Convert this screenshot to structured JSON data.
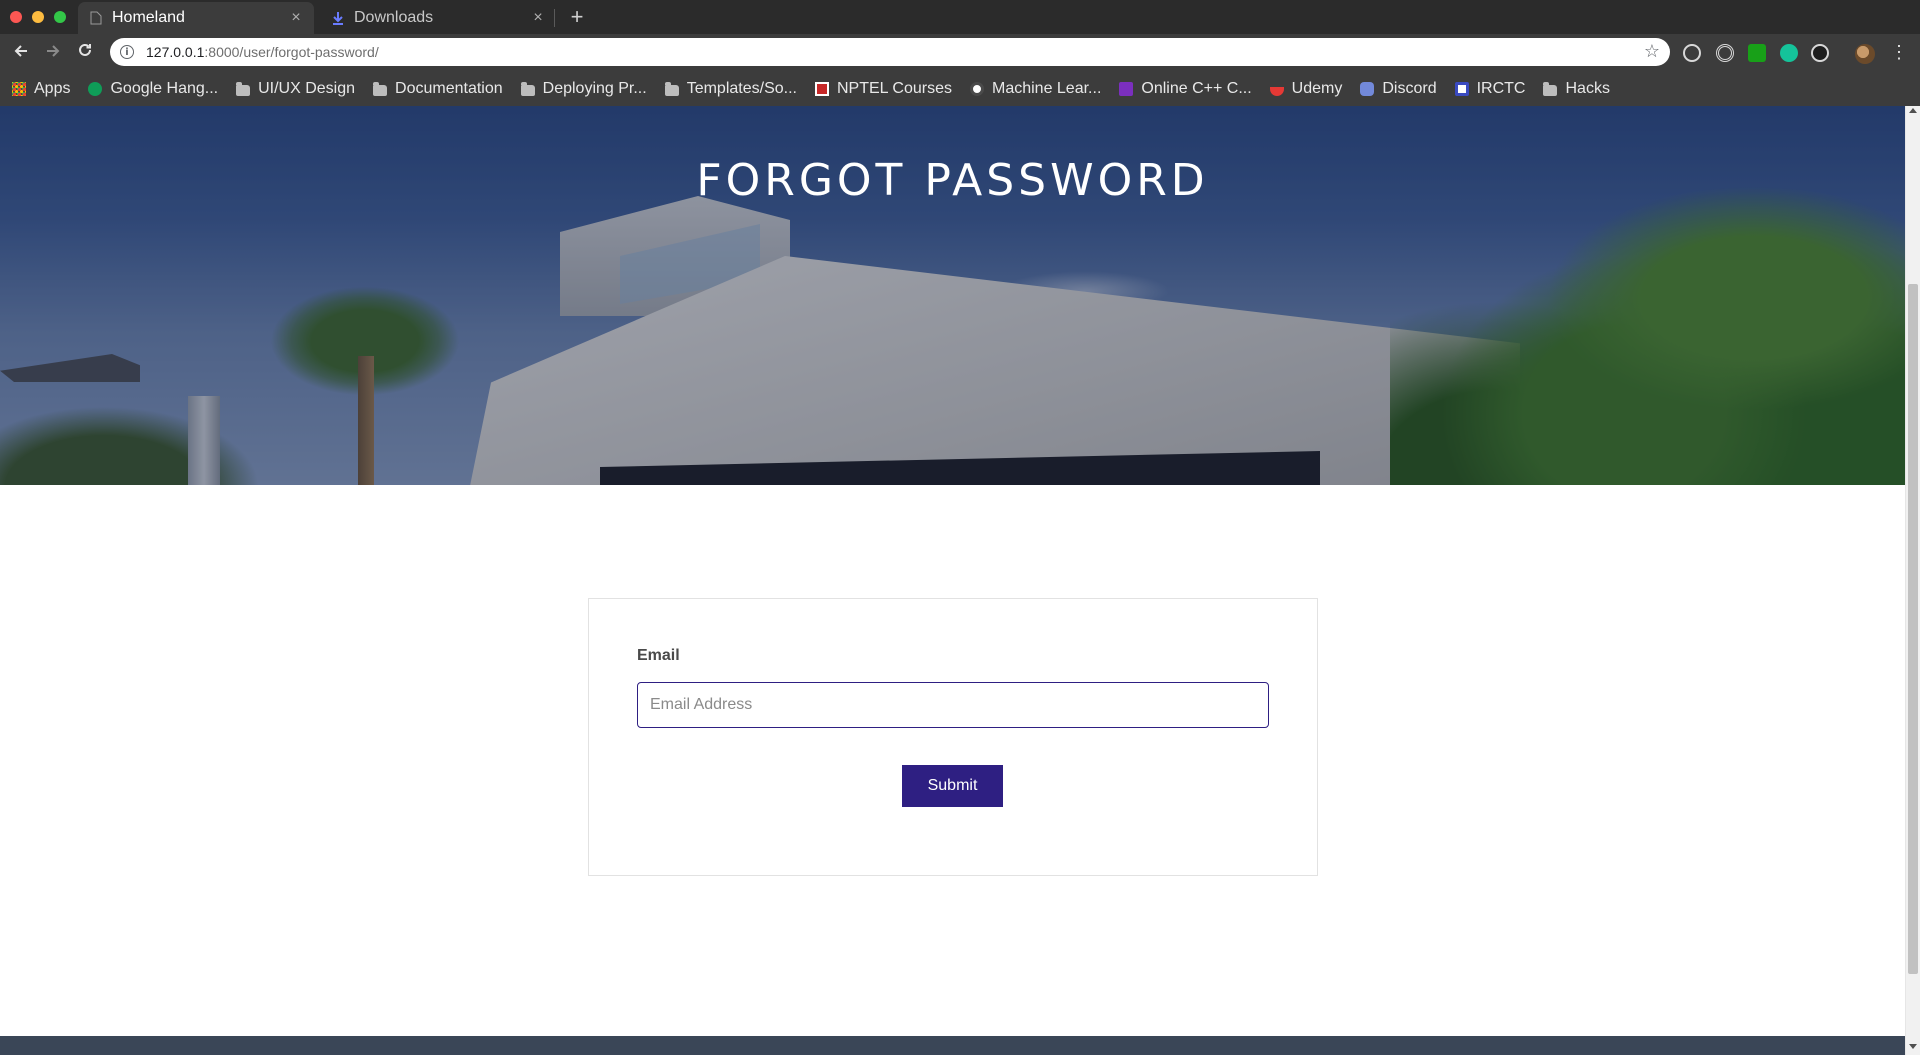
{
  "browser": {
    "tabs": [
      {
        "title": "Homeland",
        "icon": "page-icon"
      },
      {
        "title": "Downloads",
        "icon": "download-icon"
      }
    ],
    "close_glyph": "×",
    "new_tab_glyph": "+",
    "address": {
      "host": "127.0.0.1",
      "path": ":8000/user/forgot-password/"
    },
    "bookmarks": [
      {
        "label": "Apps",
        "icon": "apps-icon"
      },
      {
        "label": "Google Hang...",
        "icon": "hangouts-icon",
        "color": "#0f9d58"
      },
      {
        "label": "UI/UX Design",
        "icon": "folder-icon"
      },
      {
        "label": "Documentation",
        "icon": "folder-icon"
      },
      {
        "label": "Deploying Pr...",
        "icon": "folder-icon"
      },
      {
        "label": "Templates/So...",
        "icon": "folder-icon"
      },
      {
        "label": "NPTEL Courses",
        "icon": "nptel-icon",
        "color": "#c62828"
      },
      {
        "label": "Machine Lear...",
        "icon": "coursera-icon",
        "color": "#ffffff"
      },
      {
        "label": "Online C++ C...",
        "icon": "bolt-icon",
        "color": "#7b2fbe"
      },
      {
        "label": "Udemy",
        "icon": "udemy-icon",
        "color": "#e53935"
      },
      {
        "label": "Discord",
        "icon": "discord-icon",
        "color": "#7289da"
      },
      {
        "label": "IRCTC",
        "icon": "irctc-icon",
        "color": "#3a4ac0"
      },
      {
        "label": "Hacks",
        "icon": "folder-icon"
      }
    ]
  },
  "hero": {
    "title": "FORGOT PASSWORD"
  },
  "form": {
    "email_label": "Email",
    "email_placeholder": "Email Address",
    "email_value": "",
    "submit_label": "Submit"
  },
  "colors": {
    "primary": "#2e1f82",
    "footer": "#3a4657",
    "chrome_dark": "#2b2b2b",
    "chrome_toolbar": "#3c3c3c"
  }
}
